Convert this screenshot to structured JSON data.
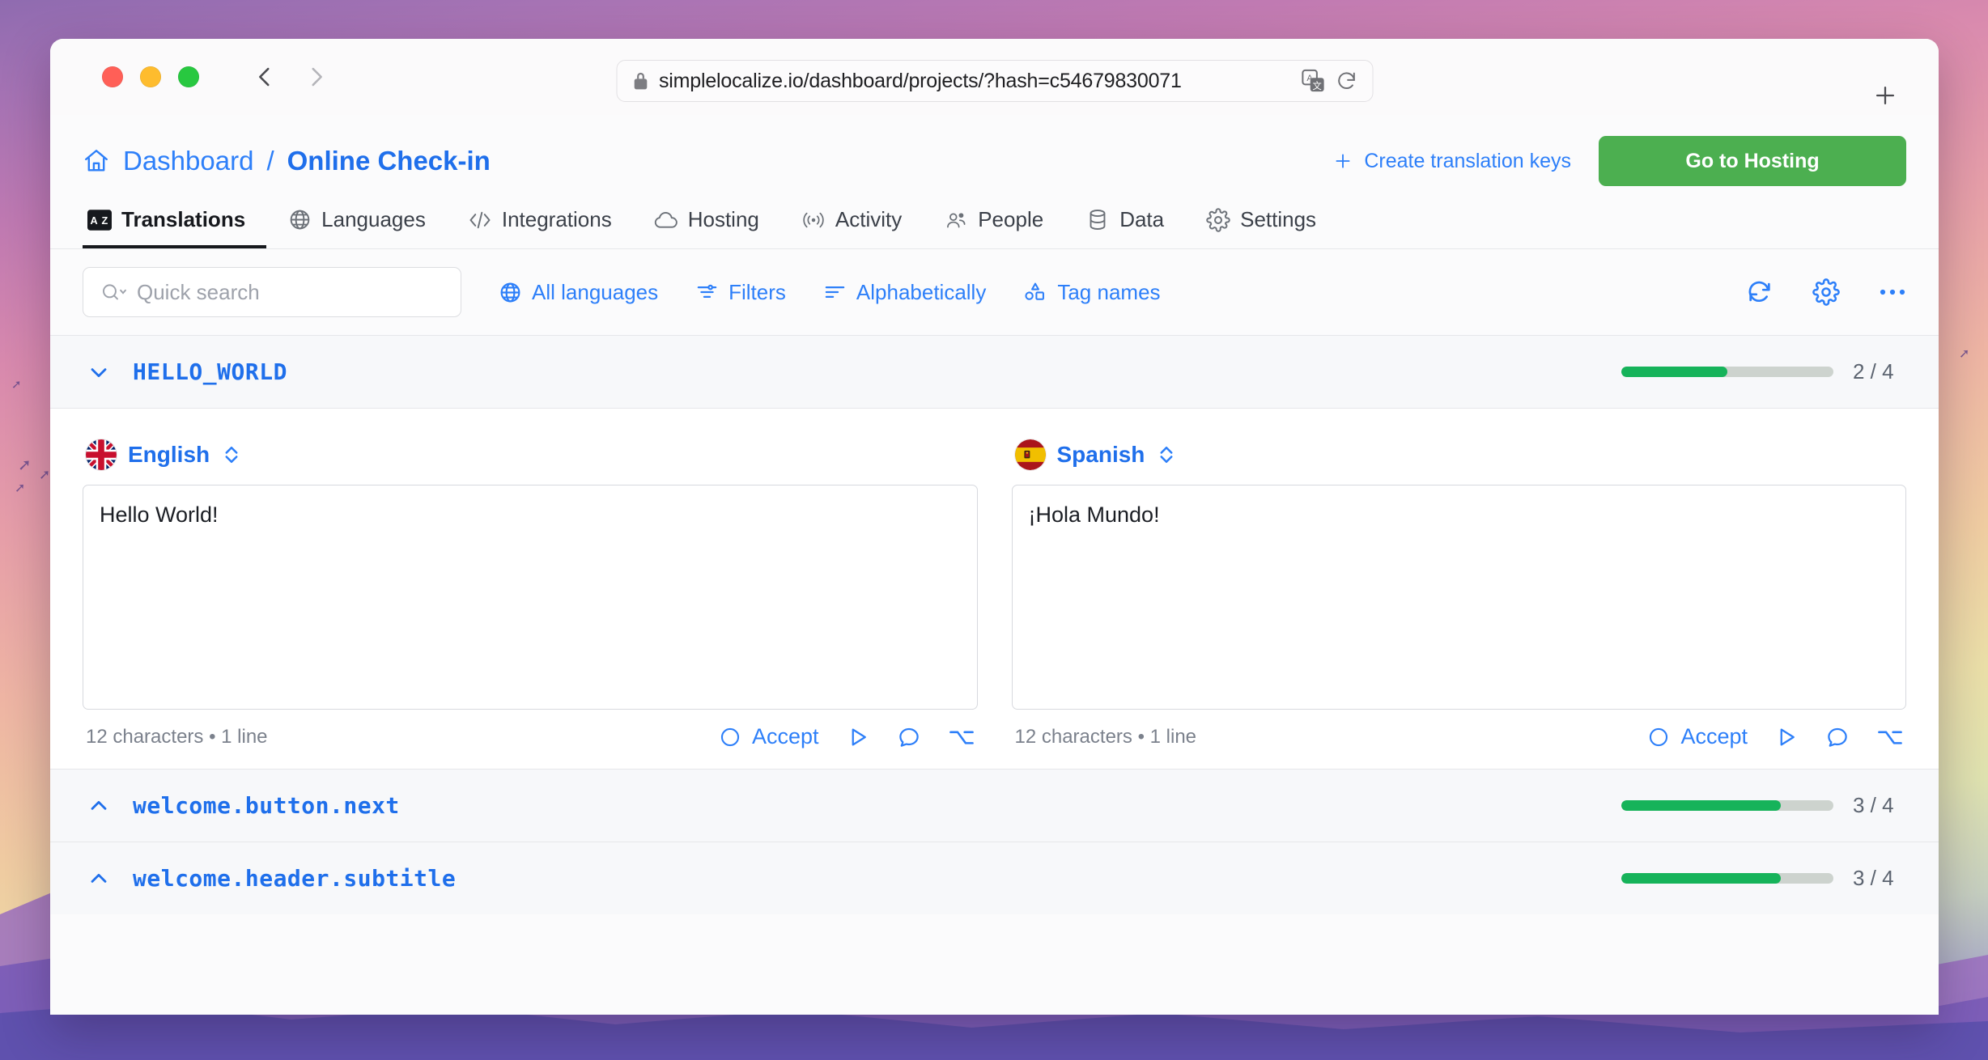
{
  "window": {
    "traffic_lights": [
      "close",
      "minimize",
      "maximize"
    ],
    "back_label": "Back",
    "forward_label": "Forward",
    "url": "simplelocalize.io/dashboard/projects/?hash=c54679830071",
    "new_tab_label": "New tab"
  },
  "header": {
    "home_icon": "home-icon",
    "breadcrumb_root": "Dashboard",
    "breadcrumb_separator": "/",
    "breadcrumb_current": "Online Check-in",
    "create_keys_label": "Create translation keys",
    "hosting_button_label": "Go to Hosting",
    "accent_green": "#4caf50",
    "accent_blue": "#2d7ff9"
  },
  "tabs": [
    {
      "label": "Translations",
      "icon": "translate-icon",
      "active": true
    },
    {
      "label": "Languages",
      "icon": "globe-icon",
      "active": false
    },
    {
      "label": "Integrations",
      "icon": "code-icon",
      "active": false
    },
    {
      "label": "Hosting",
      "icon": "cloud-icon",
      "active": false
    },
    {
      "label": "Activity",
      "icon": "broadcast-icon",
      "active": false
    },
    {
      "label": "People",
      "icon": "users-icon",
      "active": false
    },
    {
      "label": "Data",
      "icon": "database-icon",
      "active": false
    },
    {
      "label": "Settings",
      "icon": "gear-icon",
      "active": false
    }
  ],
  "toolbar": {
    "search_placeholder": "Quick search",
    "search_value": "",
    "all_languages_label": "All languages",
    "filters_label": "Filters",
    "sort_label": "Alphabetically",
    "tags_label": "Tag names",
    "refresh_icon": "refresh-icon",
    "settings_icon": "gear-icon",
    "more_icon": "ellipsis-icon"
  },
  "keys": [
    {
      "name": "HELLO_WORLD",
      "expanded": true,
      "translated": 2,
      "total": 4,
      "fraction": "2 / 4",
      "progress_percent": 50,
      "translations": [
        {
          "language": "English",
          "flag": "flag-gb",
          "value": "Hello World!",
          "meta": "12 characters • 1 line",
          "accept_label": "Accept"
        },
        {
          "language": "Spanish",
          "flag": "flag-es",
          "value": "¡Hola Mundo!",
          "meta": "12 characters • 1 line",
          "accept_label": "Accept"
        }
      ]
    },
    {
      "name": "welcome.button.next",
      "expanded": false,
      "translated": 3,
      "total": 4,
      "fraction": "3 / 4",
      "progress_percent": 75,
      "translations": []
    },
    {
      "name": "welcome.header.subtitle",
      "expanded": false,
      "translated": 3,
      "total": 4,
      "fraction": "3 / 4",
      "progress_percent": 75,
      "translations": []
    }
  ]
}
